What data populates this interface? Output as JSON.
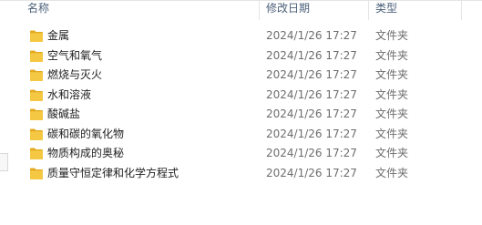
{
  "columns": {
    "name": "名称",
    "date": "修改日期",
    "type": "类型"
  },
  "rows": [
    {
      "name": "金属",
      "date": "2024/1/26 17:27",
      "type": "文件夹",
      "icon": "folder-icon"
    },
    {
      "name": "空气和氧气",
      "date": "2024/1/26 17:27",
      "type": "文件夹",
      "icon": "folder-icon"
    },
    {
      "name": "燃烧与灭火",
      "date": "2024/1/26 17:27",
      "type": "文件夹",
      "icon": "folder-icon"
    },
    {
      "name": "水和溶液",
      "date": "2024/1/26 17:27",
      "type": "文件夹",
      "icon": "folder-icon"
    },
    {
      "name": "酸碱盐",
      "date": "2024/1/26 17:27",
      "type": "文件夹",
      "icon": "folder-icon"
    },
    {
      "name": "碳和碳的氧化物",
      "date": "2024/1/26 17:27",
      "type": "文件夹",
      "icon": "folder-icon"
    },
    {
      "name": "物质构成的奥秘",
      "date": "2024/1/26 17:27",
      "type": "文件夹",
      "icon": "folder-icon"
    },
    {
      "name": "质量守恒定律和化学方程式",
      "date": "2024/1/26 17:27",
      "type": "文件夹",
      "icon": "folder-icon"
    }
  ],
  "colors": {
    "folder_front": "#f5c843",
    "folder_back": "#e3a91f",
    "header_text": "#4c607a",
    "meta_text": "#6d6d6d"
  }
}
